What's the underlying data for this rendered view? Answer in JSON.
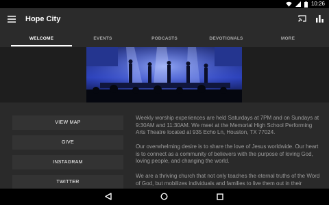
{
  "status_bar": {
    "time": "10:26",
    "icons": [
      "wifi-icon",
      "signal-icon",
      "battery-icon"
    ]
  },
  "app_bar": {
    "title": "Hope City",
    "icons": [
      "menu-icon",
      "cast-icon",
      "bar-chart-icon"
    ]
  },
  "tabs": [
    {
      "label": "WELCOME",
      "active": true
    },
    {
      "label": "EVENTS",
      "active": false
    },
    {
      "label": "PODCASTS",
      "active": false
    },
    {
      "label": "DEVOTIONALS",
      "active": false
    },
    {
      "label": "MORE",
      "active": false
    }
  ],
  "buttons": [
    {
      "label": "VIEW MAP"
    },
    {
      "label": "GIVE"
    },
    {
      "label": "INSTAGRAM"
    },
    {
      "label": "TWITTER"
    }
  ],
  "paragraphs": [
    "Weekly worship experiences are held Saturdays at 7PM and on Sundays at 9:30AM and 11:30AM. We meet at the Memorial High School Performing Arts Theatre located at 935 Echo Ln, Houston, TX 77024.",
    "Our overwhelming desire is to share the love of Jesus worldwide.  Our heart is to connect as a community of believers with the purpose of loving God, loving people, and changing the world.",
    "We are a thriving church that not only teaches the eternal truths of the Word of God, but mobilizes individuals and families to live them out in their"
  ],
  "nav_bar": {
    "icons": [
      "back-icon",
      "home-icon",
      "recents-icon"
    ]
  },
  "colors": {
    "app_bar": "#2b2b2b",
    "content_bg": "#2a2a2a",
    "button_bg": "#333333",
    "text_muted": "#9e9e9e",
    "stage_light": "#4a63ff"
  }
}
